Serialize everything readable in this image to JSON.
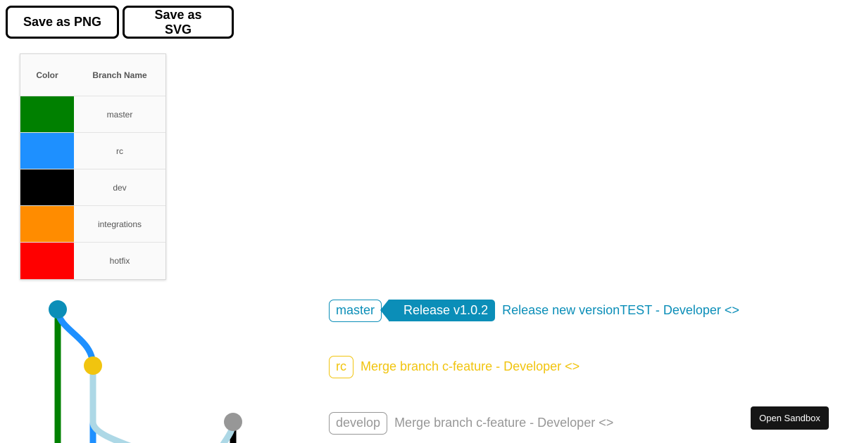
{
  "toolbar": {
    "save_png_label": "Save as PNG",
    "save_svg_label": "Save as SVG"
  },
  "legend": {
    "header_color": "Color",
    "header_branch": "Branch Name",
    "rows": [
      {
        "name": "master",
        "color": "#008000"
      },
      {
        "name": "rc",
        "color": "#1e90ff"
      },
      {
        "name": "dev",
        "color": "#000000"
      },
      {
        "name": "integrations",
        "color": "#ff8c00"
      },
      {
        "name": "hotfix",
        "color": "#ff0000"
      }
    ]
  },
  "commits": [
    {
      "branch": "master",
      "tag": "Release v1.0.2",
      "message": "Release new versionTEST - Developer <>",
      "color": "#0b8eb8"
    },
    {
      "branch": "rc",
      "message": "Merge branch c-feature - Developer <>",
      "color": "#f1c40f"
    },
    {
      "branch": "develop",
      "message": "Merge branch c-feature - Developer <>",
      "color": "#979797"
    }
  ],
  "sandbox": {
    "label": "Open Sandbox"
  }
}
